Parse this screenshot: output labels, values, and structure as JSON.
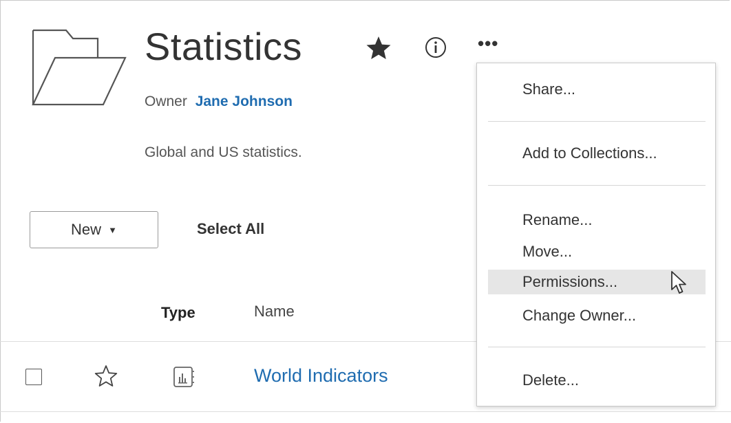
{
  "header": {
    "title": "Statistics",
    "owner_label": "Owner",
    "owner_name": "Jane Johnson",
    "description": "Global and US statistics.",
    "more_label": "•••"
  },
  "toolbar": {
    "new_label": "New",
    "new_caret": "▼",
    "select_all_label": "Select All"
  },
  "table": {
    "columns": [
      "Type",
      "Name"
    ],
    "rows": [
      {
        "name": "World Indicators",
        "type_icon": "workbook-icon",
        "favorite": false,
        "selected": false
      }
    ]
  },
  "context_menu": {
    "items": [
      {
        "label": "Share..."
      },
      {
        "label": "Add to Collections..."
      },
      {
        "label": "Rename..."
      },
      {
        "label": "Move..."
      },
      {
        "label": "Permissions...",
        "highlighted": true
      },
      {
        "label": "Change Owner..."
      },
      {
        "label": "Delete..."
      }
    ]
  },
  "colors": {
    "link": "#1f6cb0",
    "text": "#333333",
    "menu_highlight": "#e6e6e6",
    "border": "#c8c8c8"
  },
  "icons": [
    "folder-icon",
    "star-filled-icon",
    "info-icon",
    "more-icon",
    "star-outline-icon",
    "workbook-icon",
    "pointer-cursor-icon"
  ]
}
